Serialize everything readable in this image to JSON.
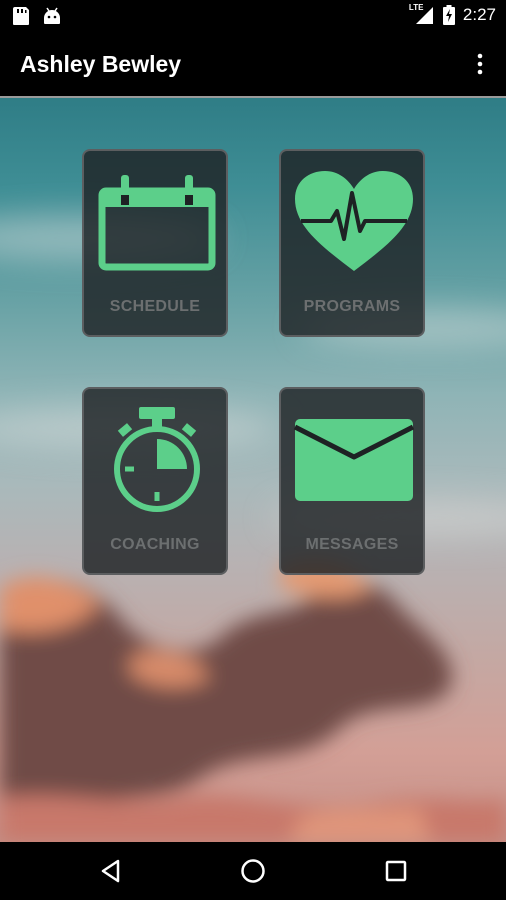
{
  "status_bar": {
    "time": "2:27",
    "network_label": "LTE",
    "icons": [
      "storage-icon",
      "android-icon",
      "signal-icon",
      "battery-charging-icon"
    ]
  },
  "app_bar": {
    "title": "Ashley Bewley",
    "overflow_icon": "more-vert-icon"
  },
  "tiles": [
    {
      "label": "SCHEDULE",
      "icon": "calendar-icon"
    },
    {
      "label": "PROGRAMS",
      "icon": "heart-pulse-icon"
    },
    {
      "label": "COACHING",
      "icon": "stopwatch-icon"
    },
    {
      "label": "MESSAGES",
      "icon": "envelope-icon"
    }
  ],
  "nav_bar": {
    "icons": [
      "back-icon",
      "home-icon",
      "recents-icon"
    ]
  },
  "colors": {
    "accent_green": "#5ccf8a",
    "tile_bg": "#1e2224",
    "label_gray": "#6c6f70"
  }
}
